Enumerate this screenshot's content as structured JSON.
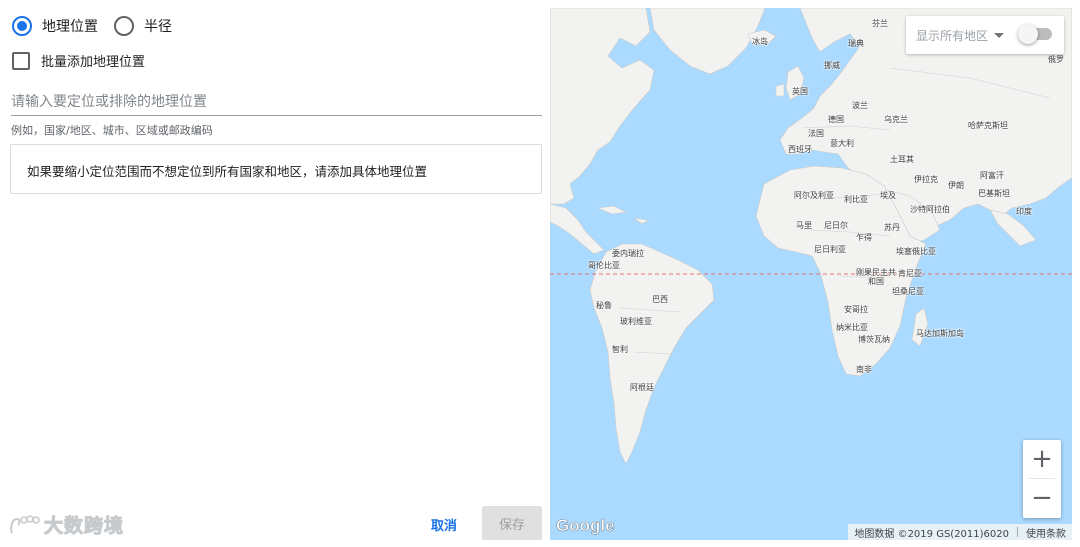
{
  "mode_options": {
    "geo_location": "地理位置",
    "radius": "半径"
  },
  "bulk_add": "批量添加地理位置",
  "search": {
    "placeholder": "请输入要定位或排除的地理位置",
    "hint": "例如，国家/地区、城市、区域或邮政编码"
  },
  "info_message": "如果要缩小定位范围而不想定位到所有国家和地区，请添加具体地理位置",
  "buttons": {
    "cancel": "取消",
    "save": "保存"
  },
  "watermark": "大数跨境",
  "map": {
    "region_filter": "显示所有地区",
    "zoom_in": "+",
    "zoom_out": "−",
    "logo": "Google",
    "attribution": "地图数据 ©2019 GS(2011)6020",
    "terms": "使用条款",
    "colors": {
      "water": "#aadaff",
      "land": "#f2f2f0",
      "border": "#c9c9c9",
      "equator": "#e57373"
    },
    "labels": [
      "芬兰",
      "瑞典",
      "冰岛",
      "挪威",
      "俄罗",
      "英国",
      "波兰",
      "德国",
      "乌克兰",
      "哈萨克斯坦",
      "法国",
      "意大利",
      "西班牙",
      "土耳其",
      "阿富汗",
      "伊拉克",
      "伊朗",
      "巴基斯坦",
      "阿尔及利亚",
      "利比亚",
      "埃及",
      "沙特阿拉伯",
      "印度",
      "马里",
      "尼日尔",
      "苏丹",
      "乍得",
      "尼日利亚",
      "埃塞俄比亚",
      "委内瑞拉",
      "哥伦比亚",
      "刚果民主共和国",
      "肯尼亚",
      "坦桑尼亚",
      "秘鲁",
      "巴西",
      "安哥拉",
      "玻利维亚",
      "纳米比亚",
      "博茨瓦纳",
      "马达加斯加岛",
      "智利",
      "南非",
      "阿根廷"
    ]
  }
}
